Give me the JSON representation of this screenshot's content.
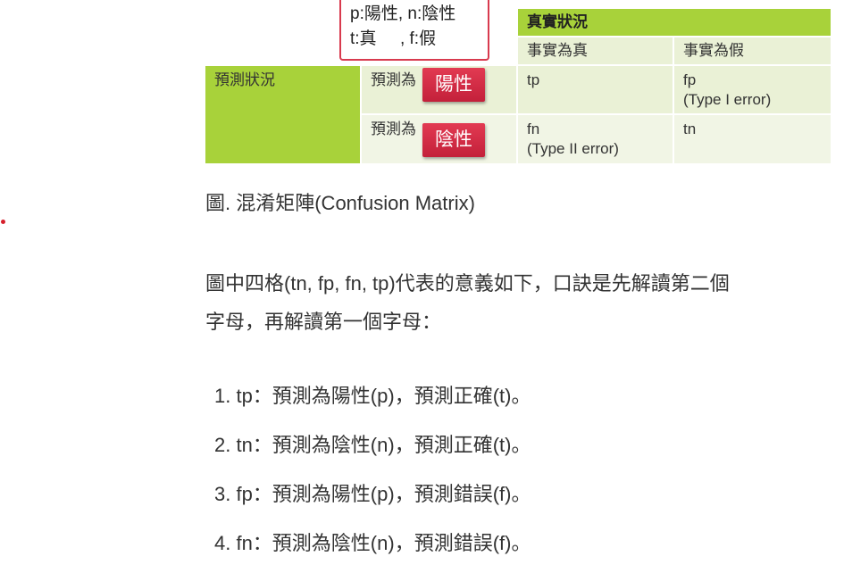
{
  "legend": {
    "line1": "p:陽性, n:陰性",
    "line2": "t:真     , f:假"
  },
  "matrix": {
    "actual_header": "真實狀況",
    "actual_true": "事實為真",
    "actual_false": "事實為假",
    "predicted_header": "預測狀況",
    "predicted_prefix": "預測為",
    "tag_positive": "陽性",
    "tag_negative": "陰性",
    "tp": "tp",
    "fp": "fp",
    "fp_note": "(Type I error)",
    "fn": "fn",
    "fn_note": "(Type II error)",
    "tn": "tn"
  },
  "caption": "圖. 混淆矩陣(Confusion Matrix)",
  "paragraph": {
    "line1": "圖中四格(tn, fp, fn, tp)代表的意義如下，口訣是先解讀第二個",
    "line2": "字母，再解讀第一個字母："
  },
  "list": [
    "1. tp：預測為陽性(p)，預測正確(t)。",
    "2. tn：預測為陰性(n)，預測正確(t)。",
    "3. fp：預測為陽性(p)，預測錯誤(f)。",
    "4. fn：預測為陰性(n)，預測錯誤(f)。"
  ],
  "colors": {
    "header_green": "#a8d23a",
    "cell_green": "#eaf1d6",
    "tag_red": "#d32c45",
    "legend_border": "#d83a4e"
  }
}
